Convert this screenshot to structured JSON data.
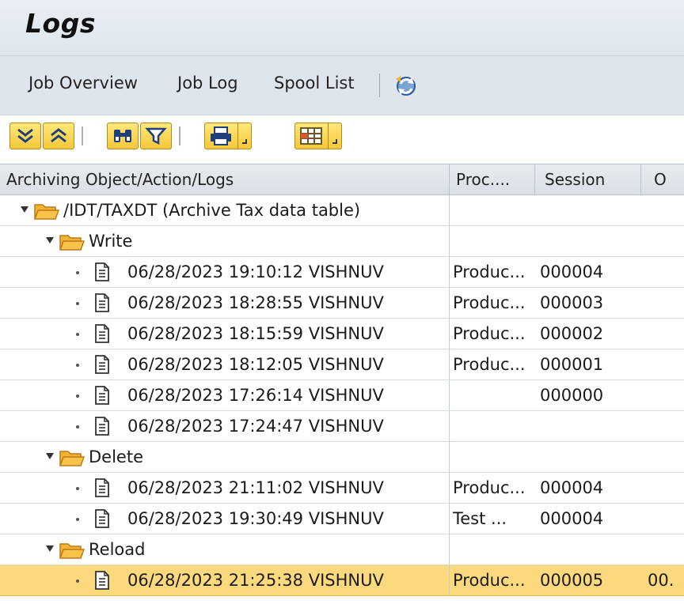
{
  "window": {
    "title": "Logs"
  },
  "menu": {
    "job_overview": "Job Overview",
    "job_log": "Job Log",
    "spool_list": "Spool List",
    "refresh_icon": "refresh-icon"
  },
  "toolbar": {
    "buttons": [
      "expand-all-icon",
      "collapse-all-icon",
      "find-icon",
      "filter-icon",
      "print-icon",
      "layout-icon"
    ]
  },
  "columns": {
    "object": "Archiving Object/Action/Logs",
    "proc": "Proc....",
    "session": "Session",
    "o": "O"
  },
  "tree": {
    "root": {
      "label": "/IDT/TAXDT (Archive Tax data table)"
    },
    "write": {
      "label": "Write",
      "logs": [
        {
          "text": "06/28/2023 19:10:12 VISHNUV",
          "proc": "Produc...",
          "session": "000004",
          "o": ""
        },
        {
          "text": "06/28/2023 18:28:55 VISHNUV",
          "proc": "Produc...",
          "session": "000003",
          "o": ""
        },
        {
          "text": "06/28/2023 18:15:59 VISHNUV",
          "proc": "Produc...",
          "session": "000002",
          "o": ""
        },
        {
          "text": "06/28/2023 18:12:05 VISHNUV",
          "proc": "Produc...",
          "session": "000001",
          "o": ""
        },
        {
          "text": "06/28/2023 17:26:14 VISHNUV",
          "proc": "",
          "session": "000000",
          "o": ""
        },
        {
          "text": "06/28/2023 17:24:47 VISHNUV",
          "proc": "",
          "session": "",
          "o": ""
        }
      ]
    },
    "delete": {
      "label": "Delete",
      "logs": [
        {
          "text": "06/28/2023 21:11:02 VISHNUV",
          "proc": "Produc...",
          "session": "000004",
          "o": ""
        },
        {
          "text": "06/28/2023 19:30:49 VISHNUV",
          "proc": "Test ...",
          "session": "000004",
          "o": ""
        }
      ]
    },
    "reload": {
      "label": "Reload",
      "logs": [
        {
          "text": "06/28/2023 21:25:38 VISHNUV",
          "proc": "Produc...",
          "session": "000005",
          "o": "00."
        }
      ]
    }
  },
  "colors": {
    "selected_row": "#fdd97e",
    "toolbar_button": "#f6c83a",
    "folder": "#f7a31c"
  }
}
